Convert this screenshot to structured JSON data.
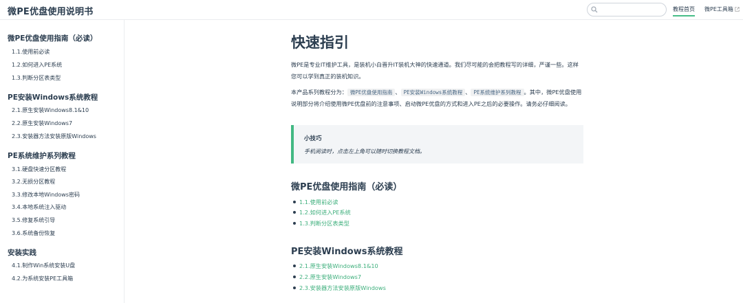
{
  "header": {
    "title": "微PE优盘使用说明书",
    "search": {
      "value": "",
      "placeholder": ""
    },
    "nav": {
      "home": "教程首页",
      "tools": "微PE工具箱"
    }
  },
  "sidebar": {
    "groups": [
      {
        "title": "微PE优盘使用指南（必读）",
        "items": [
          "1.1.使用前必读",
          "1.2.如何进入PE系统",
          "1.3.判断分区表类型"
        ]
      },
      {
        "title": "PE安装Windows系统教程",
        "items": [
          "2.1.原生安装Windows8.1&10",
          "2.2.原生安装Windows7",
          "2.3.安装器方法安装原版Windows"
        ]
      },
      {
        "title": "PE系统维护系列教程",
        "items": [
          "3.1.硬盘快速分区教程",
          "3.2.无损分区教程",
          "3.3.修改本地Windows密码",
          "3.4.本地系统注入驱动",
          "3.5.修复系统引导",
          "3.6.系统备份恢复"
        ]
      },
      {
        "title": "安装实践",
        "items": [
          "4.1.制作Win系统安装U盘",
          "4.2.为系统安装PE工具箱"
        ]
      }
    ]
  },
  "main": {
    "title": "快速指引",
    "intro": "微PE是专业IT维护工具，是装机小白晋升IT装机大神的快速通道。我们尽可能的会把教程写的详细，严谨一些。这样您可以学到真正的装机知识。",
    "series": {
      "prefix": "本产品系列教程分为：",
      "code1": "微PE优盘使用指南",
      "sep1": "、",
      "code2": "PE安装Windows系统教程",
      "sep2": "、",
      "code3": "PE系统维护系列教程",
      "suffix": "。其中，微PE优盘使用说明部分将介绍使用微PE优盘前的注意事项、启动微PE优盘的方式和进入PE之后的必要操作。请务必仔细阅读。"
    },
    "tip": {
      "title": "小技巧",
      "text": "手机阅读时，点击左上角可以随时切换教程文档。"
    },
    "sections": [
      {
        "title": "微PE优盘使用指南（必读）",
        "links": [
          "1.1.使用前必读",
          "1.2.如何进入PE系统",
          "1.3.判断分区表类型"
        ]
      },
      {
        "title": "PE安装Windows系统教程",
        "links": [
          "2.1.原生安装Windows8.1&10",
          "2.2.原生安装Windows7",
          "2.3.安装器方法安装原版Windows"
        ]
      }
    ]
  },
  "colors": {
    "accent": "#42b983",
    "text": "#2c3e50",
    "border": "#eaecef",
    "tip_bg": "#f3f5f7"
  },
  "icons": {
    "search": "search-icon",
    "external": "external-link-icon"
  }
}
